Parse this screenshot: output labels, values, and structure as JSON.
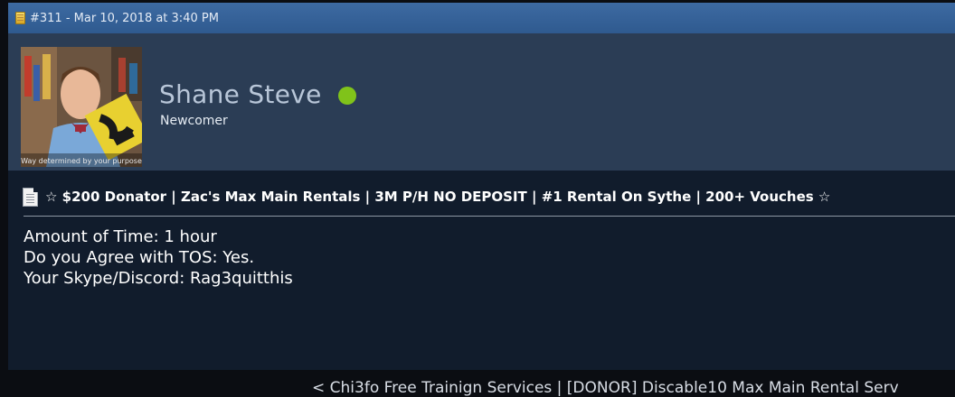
{
  "post": {
    "header": {
      "post_meta": "#311 - Mar 10, 2018 at 3:40 PM"
    },
    "author": {
      "name": "Shane Steve",
      "title": "Newcomer",
      "online_color": "#80c31a",
      "avatar_caption": "Way determined by your purpose"
    },
    "title": "☆ $200 Donator | Zac's Max Main Rentals | 3M P/H NO DEPOSIT | #1 Rental On Sythe | 200+ Vouches ☆",
    "body": {
      "lines": [
        "Amount of Time: 1 hour",
        "Do you Agree with TOS: Yes.",
        "Your Skype/Discord: Rag3quitthis"
      ]
    }
  },
  "thread_nav": {
    "text": "< Chi3fo Free Trainign Services | [DONOR] Discable10 Max Main Rental Serv"
  },
  "colors": {
    "header_bar": "#3d6aa2",
    "user_block": "#2b3d55",
    "post_bg": "#111c2c",
    "page_bg": "#0b0d12"
  }
}
